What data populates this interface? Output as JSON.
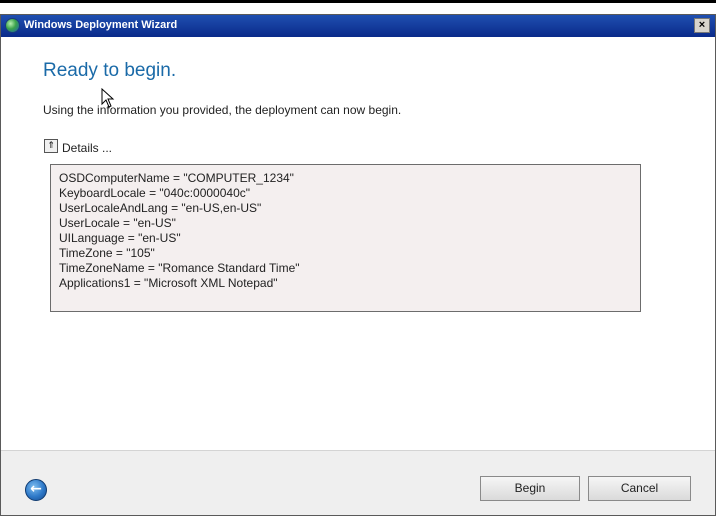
{
  "window": {
    "title": "Windows Deployment Wizard",
    "close_glyph": "×"
  },
  "page": {
    "heading": "Ready to begin.",
    "intro": "Using the information you provided, the deployment can now begin."
  },
  "details": {
    "toggle_glyph": "⇑",
    "label": "Details ...",
    "lines": [
      "OSDComputerName = \"COMPUTER_1234\"",
      "KeyboardLocale = \"040c:0000040c\"",
      "UserLocaleAndLang = \"en-US,en-US\"",
      "UserLocale = \"en-US\"",
      "UILanguage = \"en-US\"",
      "TimeZone = \"105\"",
      "TimeZoneName = \"Romance Standard Time\"",
      "Applications1 = \"Microsoft XML Notepad\""
    ]
  },
  "footer": {
    "back_glyph": "←",
    "begin_label": "Begin",
    "cancel_label": "Cancel"
  },
  "icons": {
    "title_icon": "globe-icon",
    "back": "back-arrow-icon",
    "toggle": "collapse-up-icon",
    "cursor": "mouse-cursor-icon"
  },
  "colors": {
    "titlebar": "#0a2a8a",
    "heading": "#1a6aa8",
    "details_bg": "#f4efef",
    "footer_bg": "#efefef"
  }
}
